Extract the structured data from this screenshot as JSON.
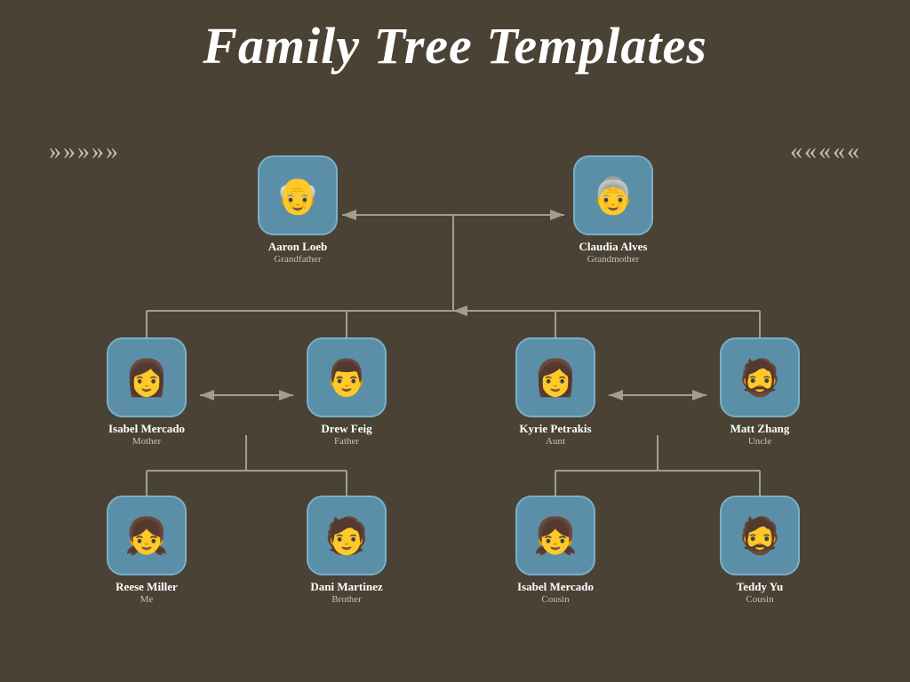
{
  "title": "Family Tree Templates",
  "chevrons": {
    "left": "»»»»»",
    "right": "«««««"
  },
  "people": {
    "aaron": {
      "name": "Aaron Loeb",
      "role": "Grandfather",
      "emoji": "👴"
    },
    "claudia": {
      "name": "Claudia Alves",
      "role": "Grandmother",
      "emoji": "👵"
    },
    "isabel_mom": {
      "name": "Isabel Mercado",
      "role": "Mother",
      "emoji": "👩"
    },
    "drew": {
      "name": "Drew Feig",
      "role": "Father",
      "emoji": "👨"
    },
    "kyrie": {
      "name": "Kyrie Petrakis",
      "role": "Aunt",
      "emoji": "👩"
    },
    "matt": {
      "name": "Matt Zhang",
      "role": "Uncle",
      "emoji": "🧔"
    },
    "reese": {
      "name": "Reese Miller",
      "role": "Me",
      "emoji": "👧"
    },
    "dani": {
      "name": "Dani Martinez",
      "role": "Brother",
      "emoji": "🧑"
    },
    "isabel_cous": {
      "name": "Isabel Mercado",
      "role": "Cousin",
      "emoji": "👧"
    },
    "teddy": {
      "name": "Teddy Yu",
      "role": "Cousin",
      "emoji": "🧔"
    }
  },
  "colors": {
    "bg": "#4a4235",
    "card": "#5b8fa8",
    "connector": "#a0a08a",
    "title": "#ffffff",
    "name": "#ffffff",
    "role": "#c8c0b0",
    "chevron": "#c8c0a8"
  }
}
